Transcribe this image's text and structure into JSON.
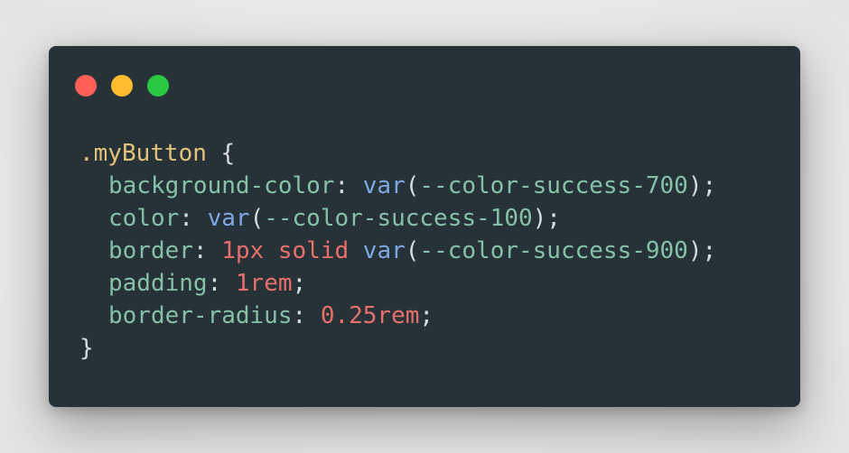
{
  "window": {
    "controls": [
      {
        "name": "close",
        "color": "#ff5f57"
      },
      {
        "name": "minimize",
        "color": "#febc2e"
      },
      {
        "name": "zoom",
        "color": "#28c840"
      }
    ]
  },
  "code": {
    "selector": ".myButton",
    "open_brace": "{",
    "close_brace": "}",
    "declarations": [
      {
        "property": "background-color",
        "value_parts": [
          {
            "type": "func",
            "text": "var"
          },
          {
            "type": "punct",
            "text": "("
          },
          {
            "type": "var",
            "text": "--color-success-700"
          },
          {
            "type": "punct",
            "text": ")"
          }
        ]
      },
      {
        "property": "color",
        "value_parts": [
          {
            "type": "func",
            "text": "var"
          },
          {
            "type": "punct",
            "text": "("
          },
          {
            "type": "var",
            "text": "--color-success-100"
          },
          {
            "type": "punct",
            "text": ")"
          }
        ]
      },
      {
        "property": "border",
        "value_parts": [
          {
            "type": "num",
            "text": "1px"
          },
          {
            "type": "punct",
            "text": " "
          },
          {
            "type": "kw",
            "text": "solid"
          },
          {
            "type": "punct",
            "text": " "
          },
          {
            "type": "func",
            "text": "var"
          },
          {
            "type": "punct",
            "text": "("
          },
          {
            "type": "var",
            "text": "--color-success-900"
          },
          {
            "type": "punct",
            "text": ")"
          }
        ]
      },
      {
        "property": "padding",
        "value_parts": [
          {
            "type": "num",
            "text": "1rem"
          }
        ]
      },
      {
        "property": "border-radius",
        "value_parts": [
          {
            "type": "num",
            "text": "0.25rem"
          }
        ]
      }
    ]
  },
  "colors": {
    "window_bg": "#263238",
    "selector": "#e2c27a",
    "property": "#85c1a8",
    "function": "#7fa8e6",
    "number": "#e8706a",
    "punctuation": "#d6dee1"
  }
}
